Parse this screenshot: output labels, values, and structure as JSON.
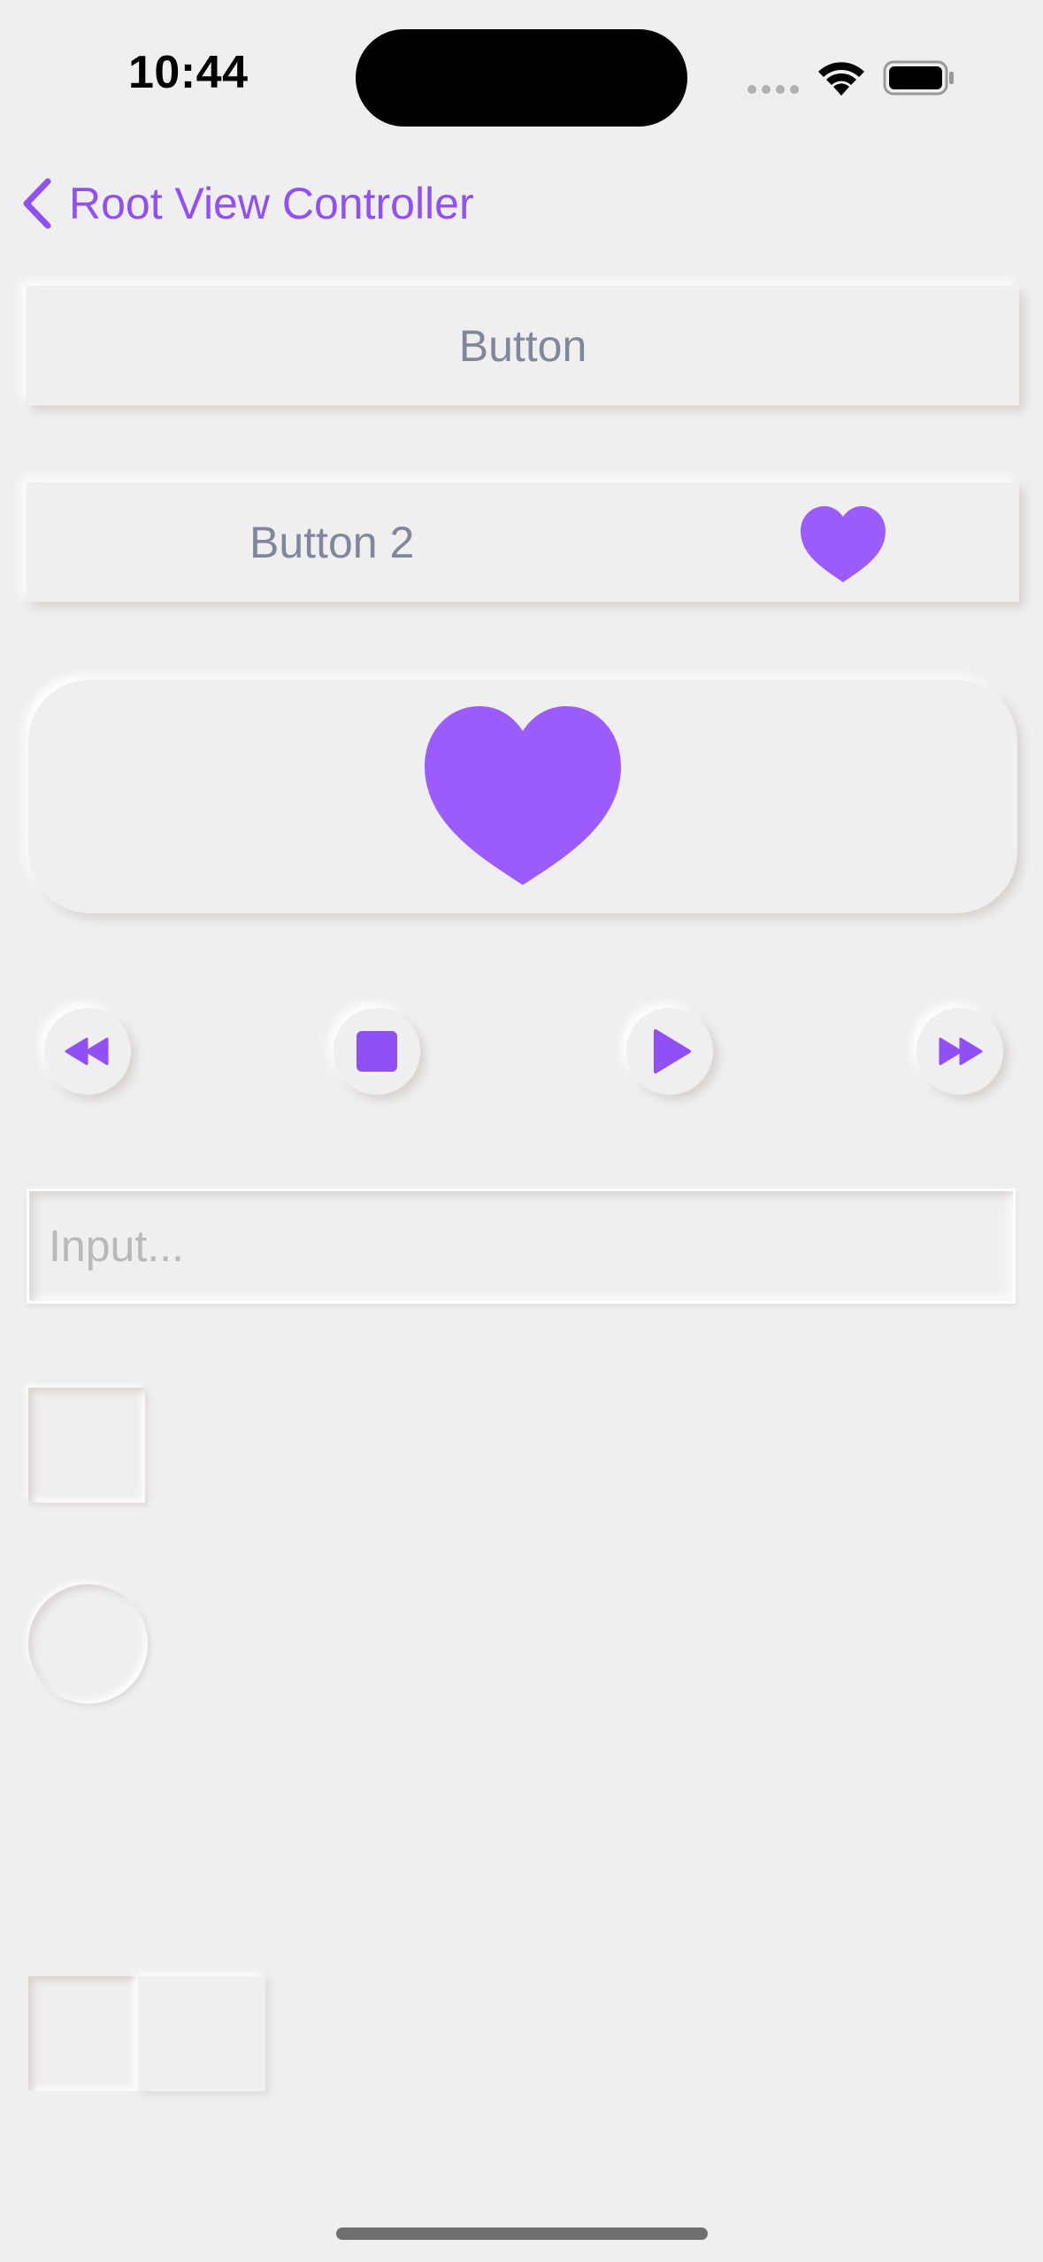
{
  "status_bar": {
    "time": "10:44",
    "icons": [
      "signal-dots-icon",
      "wifi-icon",
      "battery-icon"
    ]
  },
  "nav": {
    "back_label": "Root View Controller",
    "back_icon": "chevron-left-icon"
  },
  "buttons": {
    "button1_label": "Button",
    "button2_label": "Button 2",
    "button2_icon": "heart-icon",
    "heart_card_icon": "heart-icon"
  },
  "media_controls": [
    {
      "icon": "rewind-icon"
    },
    {
      "icon": "stop-icon"
    },
    {
      "icon": "play-icon"
    },
    {
      "icon": "fast-forward-icon"
    }
  ],
  "input": {
    "placeholder": "Input...",
    "value": ""
  },
  "checkbox": {
    "checked": false
  },
  "radio": {
    "selected": false
  },
  "colors": {
    "accent": "#9150f5",
    "heart": "#9b5cfb",
    "background": "#efefef",
    "button_text": "#80869b",
    "placeholder": "#b8b8b8"
  }
}
